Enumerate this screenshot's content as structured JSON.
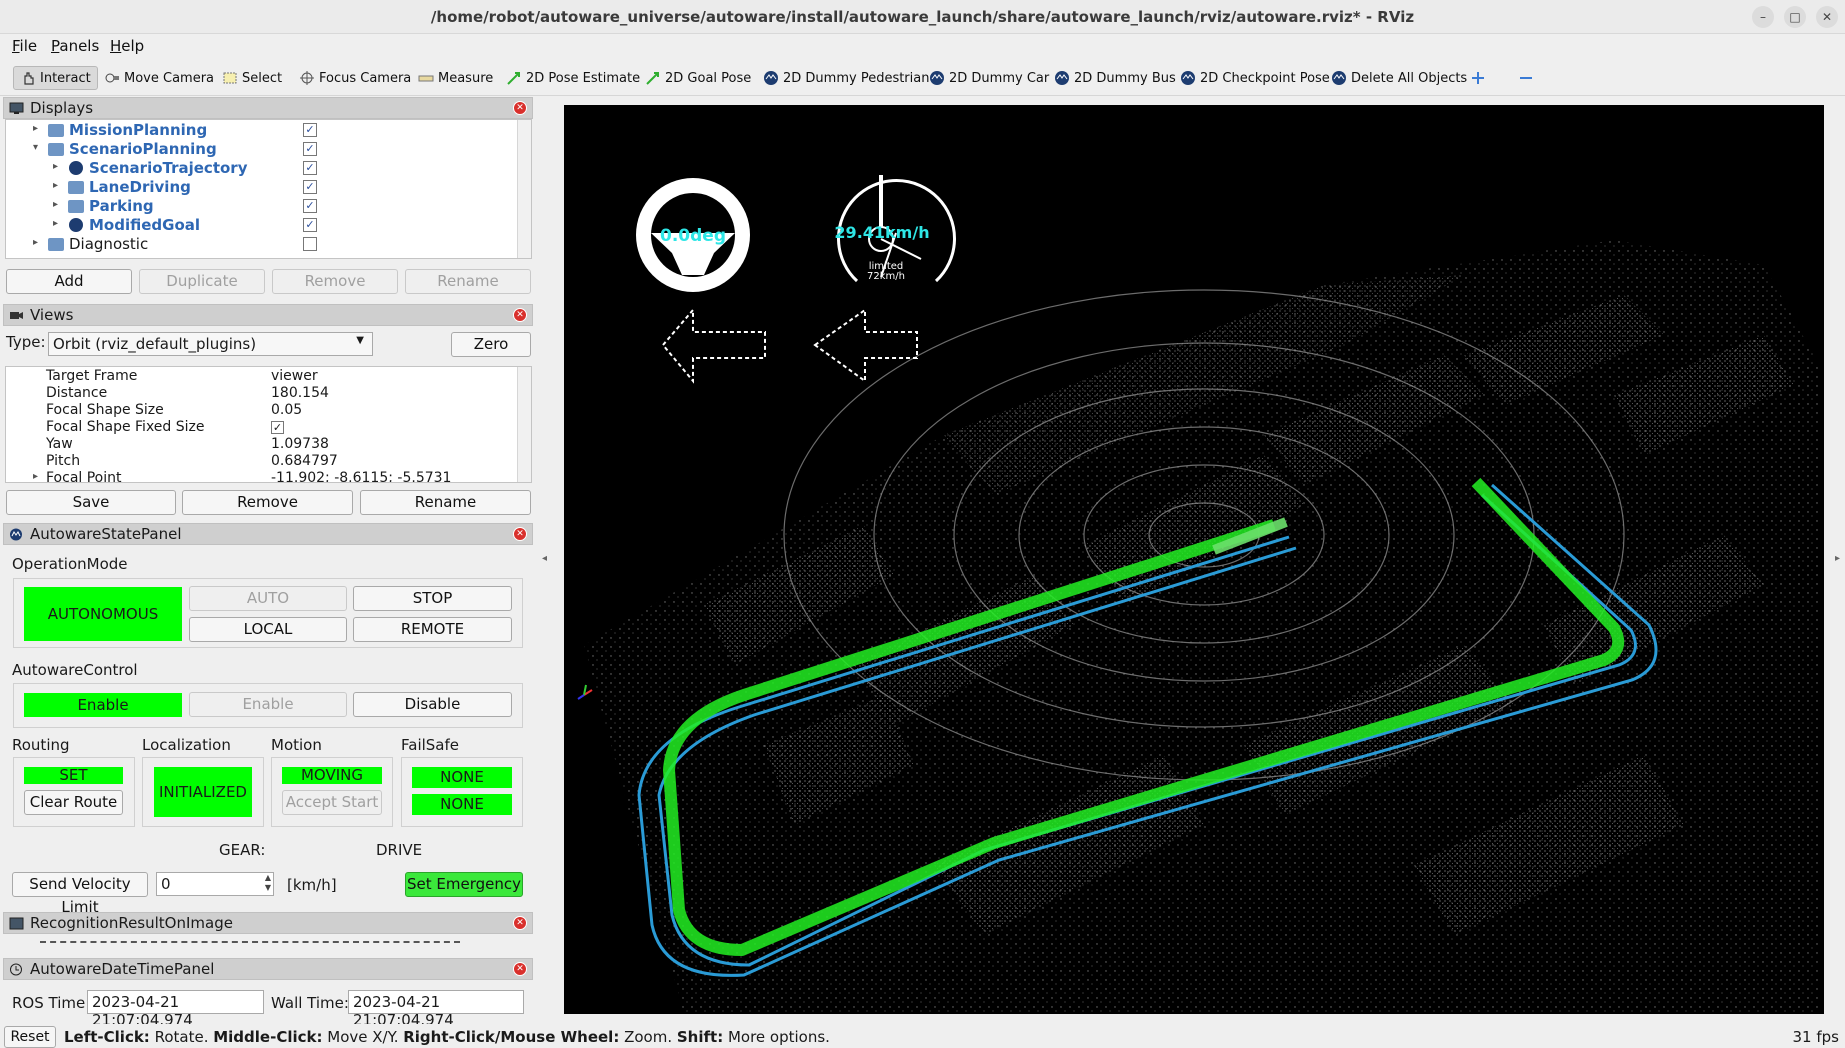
{
  "window": {
    "title": "/home/robot/autoware_universe/autoware/install/autoware_launch/share/autoware_launch/rviz/autoware.rviz* - RViz"
  },
  "menubar": {
    "items": [
      {
        "label": "File",
        "underline": "F",
        "rest": "ile"
      },
      {
        "label": "Panels",
        "underline": "P",
        "rest": "anels"
      },
      {
        "label": "Help",
        "underline": "H",
        "rest": "elp"
      }
    ]
  },
  "toolbar": {
    "tools": [
      {
        "label": "Interact",
        "icon": "hand-icon"
      },
      {
        "label": "Move Camera",
        "icon": "move-camera-icon"
      },
      {
        "label": "Select",
        "icon": "select-icon"
      },
      {
        "label": "Focus Camera",
        "icon": "focus-camera-icon"
      },
      {
        "label": "Measure",
        "icon": "ruler-icon"
      },
      {
        "label": "2D Pose Estimate",
        "icon": "green-arrow-icon"
      },
      {
        "label": "2D Goal Pose",
        "icon": "green-arrow-icon"
      },
      {
        "label": "2D Dummy Pedestrian",
        "icon": "autoware-icon"
      },
      {
        "label": "2D Dummy Car",
        "icon": "autoware-icon"
      },
      {
        "label": "2D Dummy Bus",
        "icon": "autoware-icon"
      },
      {
        "label": "2D Checkpoint Pose",
        "icon": "autoware-icon"
      },
      {
        "label": "Delete All Objects",
        "icon": "autoware-icon"
      }
    ]
  },
  "displays": {
    "title": "Displays",
    "items": [
      {
        "label": "MissionPlanning",
        "checked": true
      },
      {
        "label": "ScenarioPlanning",
        "checked": true
      },
      {
        "label": "ScenarioTrajectory",
        "checked": true
      },
      {
        "label": "LaneDriving",
        "checked": true
      },
      {
        "label": "Parking",
        "checked": true
      },
      {
        "label": "ModifiedGoal",
        "checked": true
      },
      {
        "label": "Diagnostic",
        "checked": false
      }
    ],
    "buttons": {
      "add": "Add",
      "duplicate": "Duplicate",
      "remove": "Remove",
      "rename": "Rename"
    }
  },
  "views": {
    "title": "Views",
    "type_label": "Type:",
    "type_value": "Orbit (rviz_default_plugins)",
    "zero": "Zero",
    "props": [
      {
        "name": "Target Frame",
        "value": "viewer"
      },
      {
        "name": "Distance",
        "value": "180.154"
      },
      {
        "name": "Focal Shape Size",
        "value": "0.05"
      },
      {
        "name": "Focal Shape Fixed Size",
        "value": "✓"
      },
      {
        "name": "Yaw",
        "value": "1.09738"
      },
      {
        "name": "Pitch",
        "value": "0.684797"
      },
      {
        "name": "Focal Point",
        "value": "-11.902; -8.6115; -5.5731"
      }
    ],
    "buttons": {
      "save": "Save",
      "remove": "Remove",
      "rename": "Rename"
    }
  },
  "state_panel": {
    "title": "AutowareStatePanel",
    "operation_mode": {
      "label": "OperationMode",
      "current": "AUTONOMOUS",
      "auto": "AUTO",
      "stop": "STOP",
      "local": "LOCAL",
      "remote": "REMOTE"
    },
    "control": {
      "label": "AutowareControl",
      "enable_active": "Enable",
      "enable": "Enable",
      "disable": "Disable"
    },
    "routing": {
      "label": "Routing",
      "state": "SET",
      "clear": "Clear Route"
    },
    "localization": {
      "label": "Localization",
      "state": "INITIALIZED"
    },
    "motion": {
      "label": "Motion",
      "state": "MOVING",
      "accept": "Accept Start"
    },
    "failsafe": {
      "label": "FailSafe",
      "state1": "NONE",
      "state2": "NONE"
    },
    "gear_label": "GEAR:",
    "gear_value": "DRIVE",
    "send_velocity": "Send Velocity Limit",
    "velocity_value": "0",
    "unit": "[km/h]",
    "set_emergency": "Set Emergency",
    "status_green": "#00ff00"
  },
  "recognition_panel": {
    "title": "RecognitionResultOnImage"
  },
  "datetime_panel": {
    "title": "AutowareDateTimePanel",
    "ros_label": "ROS Time:",
    "ros_value": "2023-04-21 21:07:04.974",
    "wall_label": "Wall Time:",
    "wall_value": "2023-04-21 21:07:04.974"
  },
  "viewport": {
    "steering": "0.0deg",
    "speed": "29.41km/h",
    "limit_line1": "limited",
    "limit_line2": "72km/h",
    "path_green": "#22ee22",
    "bound_blue": "#2a9bd6"
  },
  "statusbar": {
    "reset": "Reset",
    "hint_b1": "Left-Click:",
    "hint_t1": " Rotate. ",
    "hint_b2": "Middle-Click:",
    "hint_t2": " Move X/Y. ",
    "hint_b3": "Right-Click/Mouse Wheel:",
    "hint_t3": " Zoom. ",
    "hint_b4": "Shift:",
    "hint_t4": " More options.",
    "fps": "31 fps"
  }
}
